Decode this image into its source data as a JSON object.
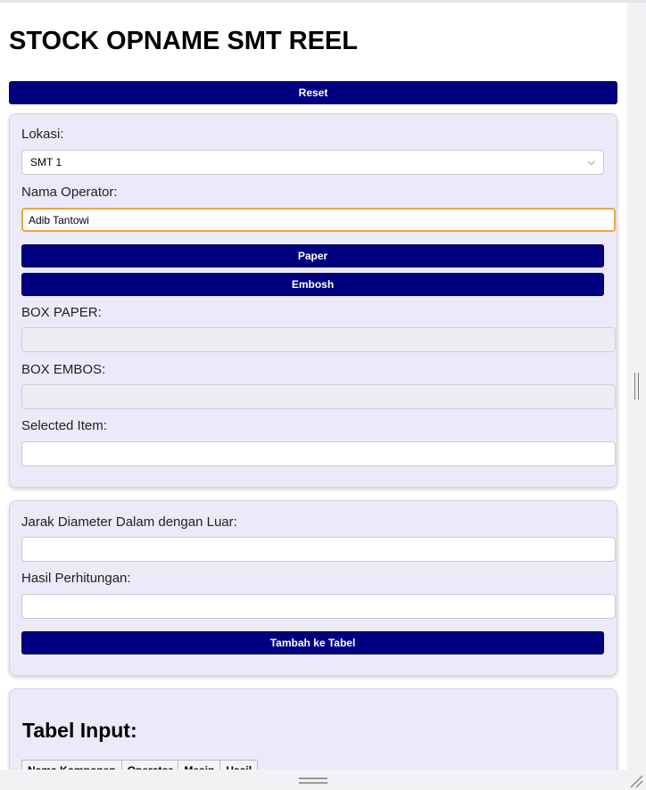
{
  "page": {
    "title": "STOCK OPNAME SMT REEL",
    "reset_label": "Reset"
  },
  "form1": {
    "lokasi_label": "Lokasi:",
    "lokasi_value": "SMT 1",
    "operator_label": "Nama Operator:",
    "operator_value": "Adib Tantowi",
    "paper_label": "Paper",
    "embosh_label": "Embosh",
    "box_paper_label": "BOX PAPER:",
    "box_paper_value": "",
    "box_embos_label": "BOX EMBOS:",
    "box_embos_value": "",
    "selected_item_label": "Selected Item:",
    "selected_item_value": ""
  },
  "form2": {
    "jarak_label": "Jarak Diameter Dalam dengan Luar:",
    "jarak_value": "",
    "hasil_label": "Hasil Perhitungan:",
    "hasil_value": "",
    "add_label": "Tambah ke Tabel"
  },
  "table": {
    "title": "Tabel Input:",
    "columns": [
      "Nama Komponen",
      "Operator",
      "Mesin",
      "Hasil"
    ]
  },
  "icons": {
    "dropdown": "chevron-down-icon",
    "resize_vertical": "grip-icon",
    "resize_corner": "resize-corner-icon"
  },
  "colors": {
    "primary_button": "#000080",
    "panel_bg": "#eaeaf8",
    "focus_border": "#e8a640"
  }
}
